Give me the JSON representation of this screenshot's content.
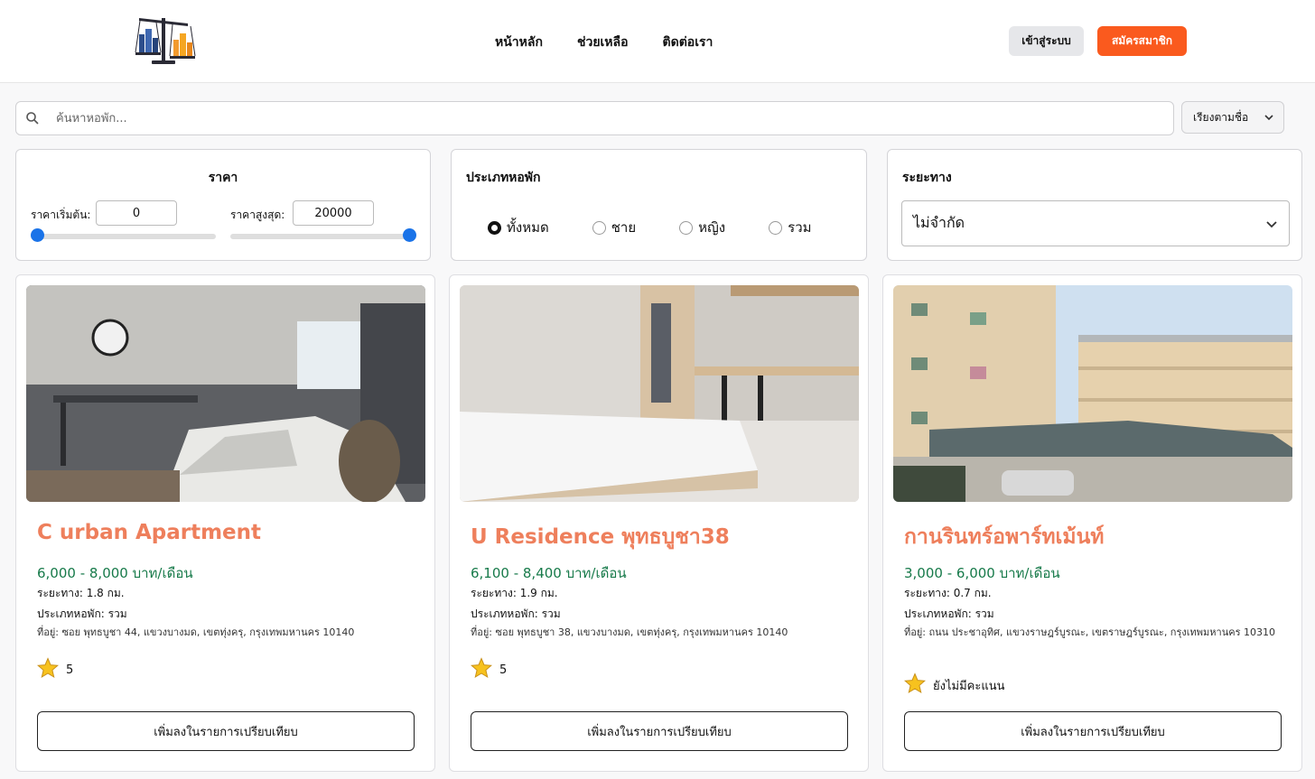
{
  "header": {
    "nav": [
      "หน้าหลัก",
      "ช่วยเหลือ",
      "ติดต่อเรา"
    ],
    "login_label": "เข้าสู่ระบบ",
    "signup_label": "สมัครสมาชิก"
  },
  "search": {
    "placeholder": "ค้นหาหอพัก...",
    "sort_label": "เรียงตามชื่อ"
  },
  "filters": {
    "price": {
      "title": "ราคา",
      "min_label": "ราคาเริ่มต้น:",
      "min_value": "0",
      "max_label": "ราคาสูงสุด:",
      "max_value": "20000"
    },
    "type": {
      "title": "ประเภทหอพัก",
      "options": [
        "ทั้งหมด",
        "ชาย",
        "หญิง",
        "รวม"
      ],
      "selected": "ทั้งหมด"
    },
    "distance": {
      "title": "ระยะทาง",
      "selected": "ไม่จำกัด"
    }
  },
  "listings": [
    {
      "name": "C urban Apartment",
      "price": "6,000 - 8,000 บาท/เดือน",
      "distance": "ระยะทาง: 1.8 กม.",
      "type": "ประเภทหอพัก: รวม",
      "address": "ที่อยู่: ซอย พุทธบูชา 44, แขวงบางมด, เขตทุ่งครุ, กรุงเทพมหานคร 10140",
      "rating": "5",
      "compare_label": "เพิ่มลงในรายการเปรียบเทียบ"
    },
    {
      "name": "U Residence พุทธบูชา38",
      "price": "6,100 - 8,400 บาท/เดือน",
      "distance": "ระยะทาง: 1.9 กม.",
      "type": "ประเภทหอพัก: รวม",
      "address": "ที่อยู่: ซอย พุทธบูชา 38, แขวงบางมด, เขตทุ่งครุ, กรุงเทพมหานคร 10140",
      "rating": "5",
      "compare_label": "เพิ่มลงในรายการเปรียบเทียบ"
    },
    {
      "name": "กานรินทร์อพาร์ทเม้นท์",
      "price": "3,000 - 6,000 บาท/เดือน",
      "distance": "ระยะทาง: 0.7 กม.",
      "type": "ประเภทหอพัก: รวม",
      "address": "ที่อยู่: ถนน ประชาอุทิศ, แขวงราษฎร์บูรณะ, เขตราษฎร์บูรณะ, กรุงเทพมหานคร 10310",
      "rating": "ยังไม่มีคะแนน",
      "compare_label": "เพิ่มลงในรายการเปรียบเทียบ"
    }
  ],
  "colors": {
    "accent": "#fa5a1e",
    "title": "#ee7f5c",
    "price": "#177a4a",
    "slider": "#1a73e8"
  },
  "icons": [
    "scales-logo-icon",
    "search-icon",
    "chevron-down-icon",
    "star-icon"
  ]
}
